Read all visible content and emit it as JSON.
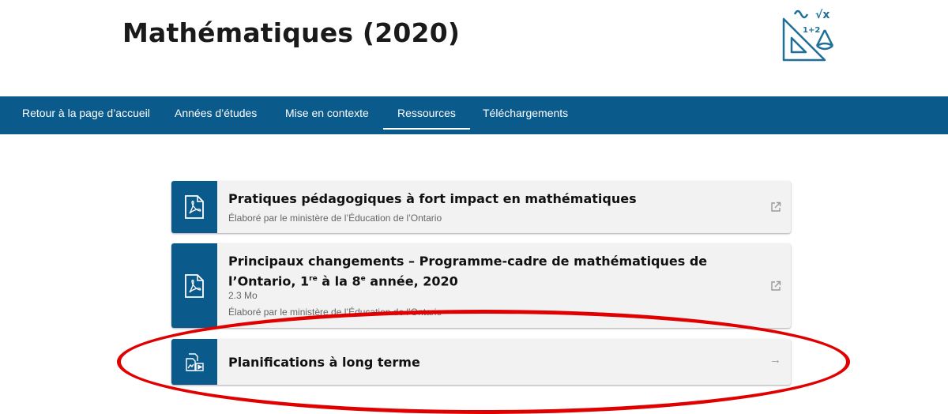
{
  "header": {
    "title": "Mathématiques (2020)"
  },
  "logo": {
    "icon": "math-tools-icon",
    "symbols": [
      "√x",
      "1+2"
    ]
  },
  "nav": {
    "items": [
      {
        "label": "Retour à la page d’accueil",
        "active": false
      },
      {
        "label": "Années d’études",
        "active": false
      },
      {
        "label": "Mise en contexte",
        "active": false
      },
      {
        "label": "Ressources",
        "active": true
      },
      {
        "label": "Téléchargements",
        "active": false
      }
    ]
  },
  "resources": [
    {
      "title": "Pratiques pédagogiques à fort impact en mathématiques",
      "author": "Élaboré par le ministère de l’Éducation de l’Ontario",
      "icon": "pdf-file-icon",
      "action_icon": "external-link-icon"
    },
    {
      "title_part1": "Principaux changements – Programme-cadre de mathématiques de l’Ontario, 1",
      "title_sup1": "re",
      "title_part2": " à la 8",
      "title_sup2": "e",
      "title_part3": " année, 2020",
      "size": "2.3 Mo",
      "author": "Élaboré par le ministère de l’Éducation de l’Ontario",
      "icon": "pdf-file-icon",
      "action_icon": "external-link-icon"
    },
    {
      "title": "Planifications à long terme",
      "icon": "media-files-icon",
      "action_icon": "arrow-right-icon",
      "action_glyph": "→"
    }
  ],
  "colors": {
    "brand_blue": "#0b5a8c",
    "card_bg": "#f2f2f3",
    "annotation_red": "#e10000"
  }
}
